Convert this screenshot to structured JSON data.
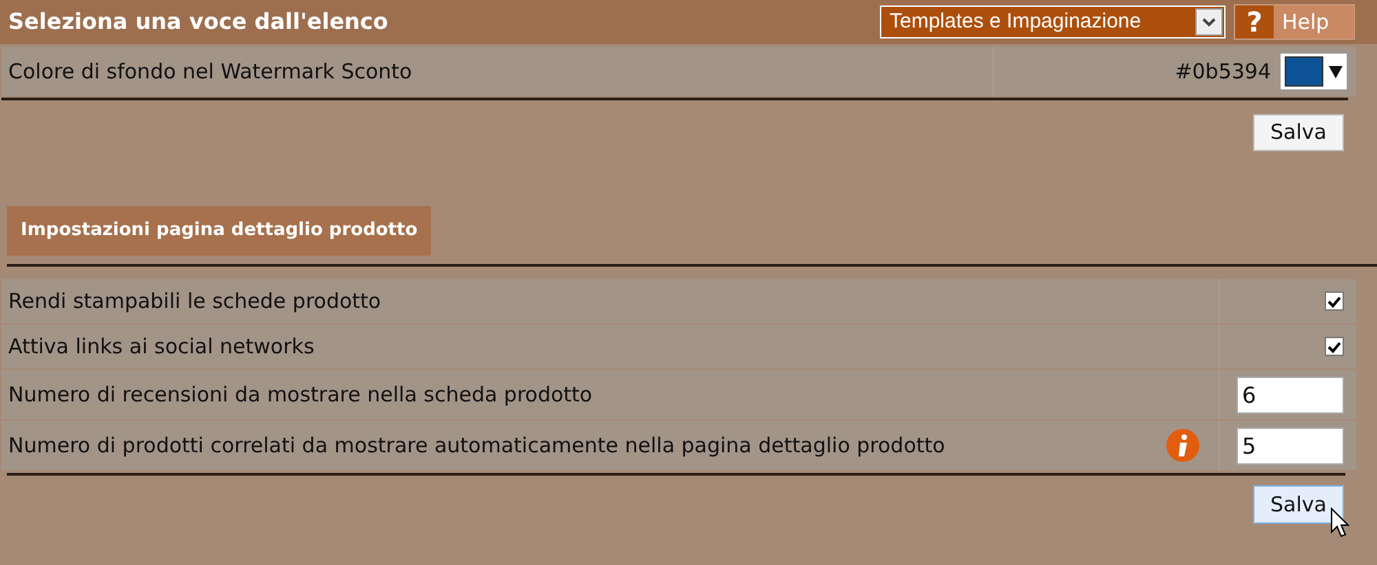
{
  "header": {
    "title": "Seleziona una voce dall'elenco",
    "dropdown": "Templates e Impaginazione",
    "help_icon": "?",
    "help": "Help"
  },
  "color_setting": {
    "label": "Colore di sfondo nel Watermark Sconto",
    "value": "#0b5394",
    "color": "#0b5394"
  },
  "save_top": "Salva",
  "section": {
    "title": "Impostazioni pagina dettaglio prodotto"
  },
  "settings": [
    {
      "kind": "checkbox",
      "label": "Rendi stampabili le schede prodotto",
      "checked": true
    },
    {
      "kind": "checkbox",
      "label": "Attiva links ai social networks",
      "checked": true
    },
    {
      "kind": "number",
      "label": "Numero di recensioni da mostrare nella scheda prodotto",
      "value": "6",
      "info": false
    },
    {
      "kind": "number",
      "label": "Numero di prodotti correlati da mostrare automaticamente nella pagina dettaglio prodotto",
      "value": "5",
      "info": true
    }
  ],
  "save_bottom": {
    "label": "Salva",
    "hovered": true
  }
}
